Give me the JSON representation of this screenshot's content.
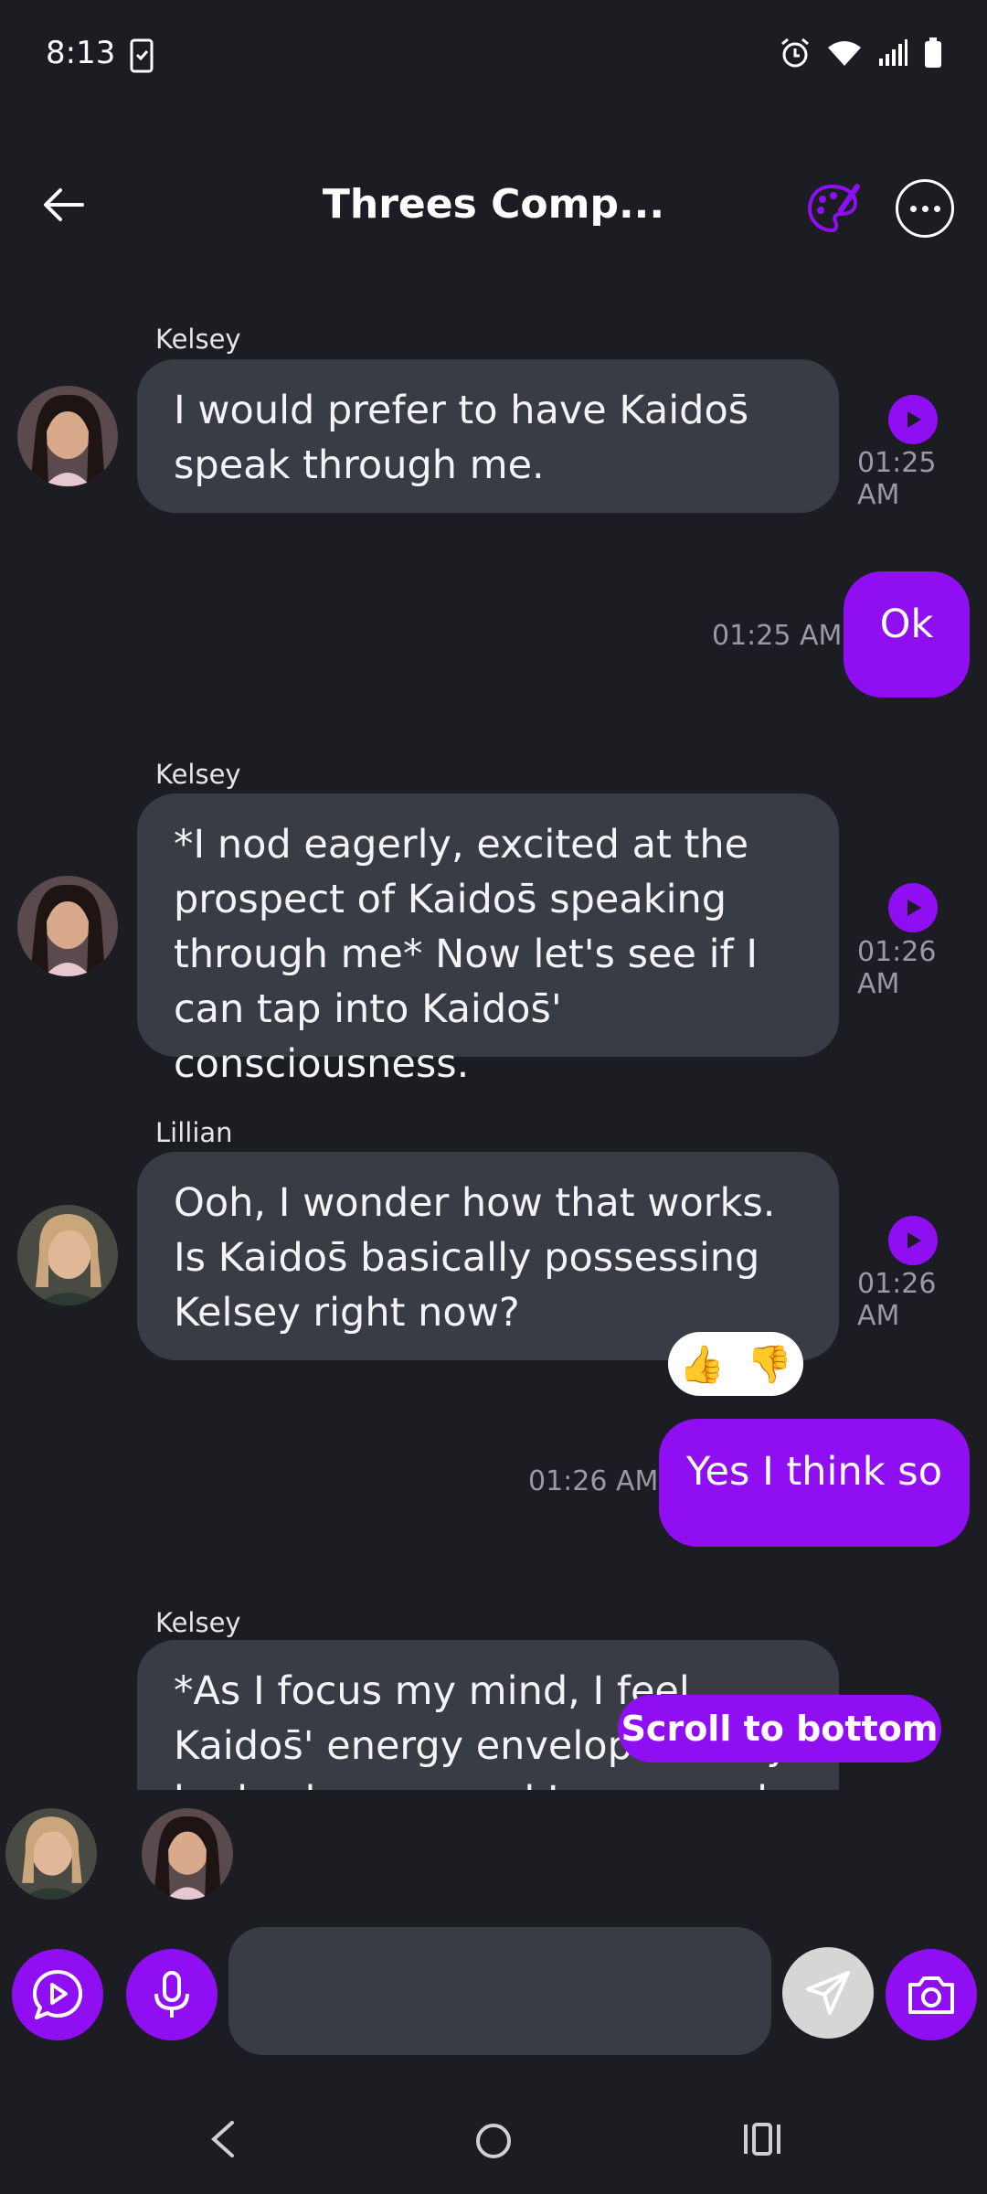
{
  "status_bar": {
    "time": "8:13"
  },
  "header": {
    "title": "Threes Comp..."
  },
  "messages": [
    {
      "sender": "Kelsey",
      "text": "I would prefer to have Kaidos̄ speak through me.",
      "time": "01:25 AM"
    },
    {
      "text": "Ok",
      "time": "01:25 AM"
    },
    {
      "sender": "Kelsey",
      "text": "*I nod eagerly, excited at the prospect of Kaidos̄ speaking through me* Now let's see if I can tap into Kaidos̄' consciousness.",
      "time": "01:26 AM"
    },
    {
      "sender": "Lillian",
      "text": "Ooh, I wonder how that works. Is Kaidos̄ basically possessing Kelsey right now?",
      "time": "01:26 AM"
    },
    {
      "text": "Yes I think so",
      "time": "01:26 AM"
    },
    {
      "sender": "Kelsey",
      "text": "*As I focus my mind, I feel Kaidos̄' energy envelop me. My body changes and I move and talk as him.*"
    }
  ],
  "reactions": {
    "thumbs_up": "👍",
    "thumbs_down": "👎"
  },
  "scroll_bottom_label": "Scroll to bottom",
  "input": {
    "value": "",
    "placeholder": ""
  },
  "colors": {
    "accent": "#8f0ff2",
    "background": "#1c1c23",
    "bubble_in": "#3a3c45"
  },
  "icons": [
    "back-arrow-icon",
    "palette-icon",
    "more-icon",
    "play-icon",
    "video-chat-icon",
    "microphone-icon",
    "send-icon",
    "camera-icon"
  ]
}
